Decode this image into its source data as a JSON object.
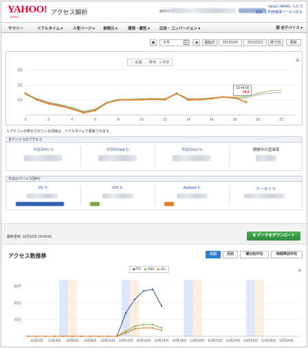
{
  "header": {
    "logo": "YAHOO!",
    "logo_sub": "JAPAN",
    "app_title": "アクセス解析",
    "account_label": "解析ID:",
    "links_row1": [
      "Yahoo! JAPAN",
      "ヘルプ"
    ],
    "links_row2": [
      "設定",
      "ご利用環境ツールへ戻る"
    ]
  },
  "nav": {
    "items": [
      "サマリー",
      "リアルタイム",
      "人気ページ",
      "参照元",
      "環境・属性",
      "広告・コンバージョン"
    ],
    "device": "全デバイス"
  },
  "controls": {
    "period": "今月",
    "start_label": "開始日",
    "start_date": "2013/10/0",
    "end_date": "2013/10/3",
    "end_label": "終了日",
    "update": "更新"
  },
  "realtime": {
    "legend": [
      "先週",
      "昨日",
      "今日"
    ],
    "tooltip_time": "19:44:05",
    "tooltip_value": "+4,9",
    "note": "アイコンが表示されている項目は、リアルタイムで更新されます。"
  },
  "access": {
    "header": "全デバイスのアクセス",
    "cells": [
      "今日のPV",
      "今日のVisit",
      "今日のUU",
      "期間中の直帰率"
    ]
  },
  "devices": {
    "header": "今日のデバイス別PV",
    "cells": [
      "PC",
      "iOS",
      "Android",
      "ケータイ"
    ]
  },
  "footer": {
    "last_update": "最終更新: 10月16日 18:49:59",
    "download": "データをダウンロード"
  },
  "trend": {
    "title": "アクセス数推移",
    "tabs": [
      "日別",
      "月別",
      "曜日別平均",
      "時間帯別平均"
    ],
    "legend": [
      "PV",
      "Visit",
      "UU"
    ]
  },
  "colors": {
    "accent": "#2a7fd1",
    "orange": "#e87a1e",
    "green": "#7aa53a",
    "navy": "#1f4e8c",
    "logo": "#e60033"
  },
  "chart_data": [
    {
      "type": "line",
      "title": "",
      "x": [
        0,
        1,
        2,
        3,
        4,
        5,
        6,
        7,
        8,
        9,
        10,
        11,
        12,
        13,
        14,
        15,
        16,
        17,
        18,
        19,
        20,
        21,
        22
      ],
      "xticks": [
        "0",
        "2",
        "4",
        "6",
        "8",
        "10",
        "12",
        "14",
        "16",
        "18",
        "20",
        "22"
      ],
      "yticks": [
        "1万",
        "2万",
        "3万"
      ],
      "ylim": [
        0,
        3.2
      ],
      "series": [
        {
          "name": "先週",
          "values": [
            1.4,
            1.1,
            0.85,
            0.7,
            0.5,
            0.25,
            0.4,
            0.85,
            1.05,
            1.05,
            1.08,
            1.1,
            1.08,
            1.45,
            1.1,
            1.08,
            1.15,
            1.22,
            1.18,
            1.22,
            1.45,
            1.6,
            1.65
          ]
        },
        {
          "name": "昨日",
          "values": [
            1.35,
            1.05,
            0.8,
            0.65,
            0.45,
            0.2,
            0.35,
            0.8,
            1.0,
            1.0,
            1.05,
            1.05,
            1.05,
            1.4,
            1.05,
            1.05,
            1.1,
            1.18,
            1.1,
            1.15,
            1.35,
            1.45,
            1.5
          ]
        },
        {
          "name": "今日",
          "values": [
            1.45,
            1.0,
            0.75,
            0.6,
            0.4,
            0.15,
            0.3,
            0.8,
            1.0,
            1.0,
            1.02,
            1.05,
            1.02,
            1.45,
            1.0,
            1.02,
            1.1,
            1.2,
            1.15,
            0.85
          ]
        }
      ]
    },
    {
      "type": "line",
      "title": "",
      "categories": [
        "10月1日",
        "10月2日",
        "10月3日",
        "10月4日",
        "10月5日",
        "10月6日",
        "10月7日",
        "10月8日",
        "10月9日",
        "10月10日",
        "10月11日",
        "10月12日",
        "10月13日",
        "10月14日",
        "10月15日",
        "10月16日",
        "10月17日",
        "10月18日",
        "10月19日",
        "10月20日",
        "10月21日",
        "10月22日",
        "10月23日",
        "10月24日",
        "10月25日",
        "10月26日",
        "10月27日",
        "10月28日",
        "10月29日",
        "10月30日",
        "10月31日"
      ],
      "xticks": [
        "10月2日",
        "10月4日",
        "10月6日",
        "10月8日",
        "10月10日",
        "10月12日",
        "10月14日",
        "10月16日",
        "10月18日",
        "10月20日",
        "10月22日",
        "10月24日",
        "10月26日",
        "10月28日",
        "10月30日"
      ],
      "yticks": [
        "10万",
        "20万",
        "30万"
      ],
      "ylim": [
        0,
        32
      ],
      "series": [
        {
          "name": "PV",
          "values": [
            0,
            0,
            0,
            0,
            0,
            0,
            0,
            0,
            0,
            0,
            0,
            14,
            22,
            27,
            28,
            18
          ]
        },
        {
          "name": "Visit",
          "values": [
            0,
            0,
            0,
            0,
            0,
            0,
            0,
            0,
            0,
            0,
            0,
            3,
            6,
            7,
            7,
            5
          ]
        },
        {
          "name": "UU",
          "values": [
            0,
            0,
            0,
            0,
            0,
            0,
            0,
            0,
            0,
            0,
            0,
            2,
            4.5,
            5,
            5,
            3.5
          ]
        }
      ]
    }
  ]
}
